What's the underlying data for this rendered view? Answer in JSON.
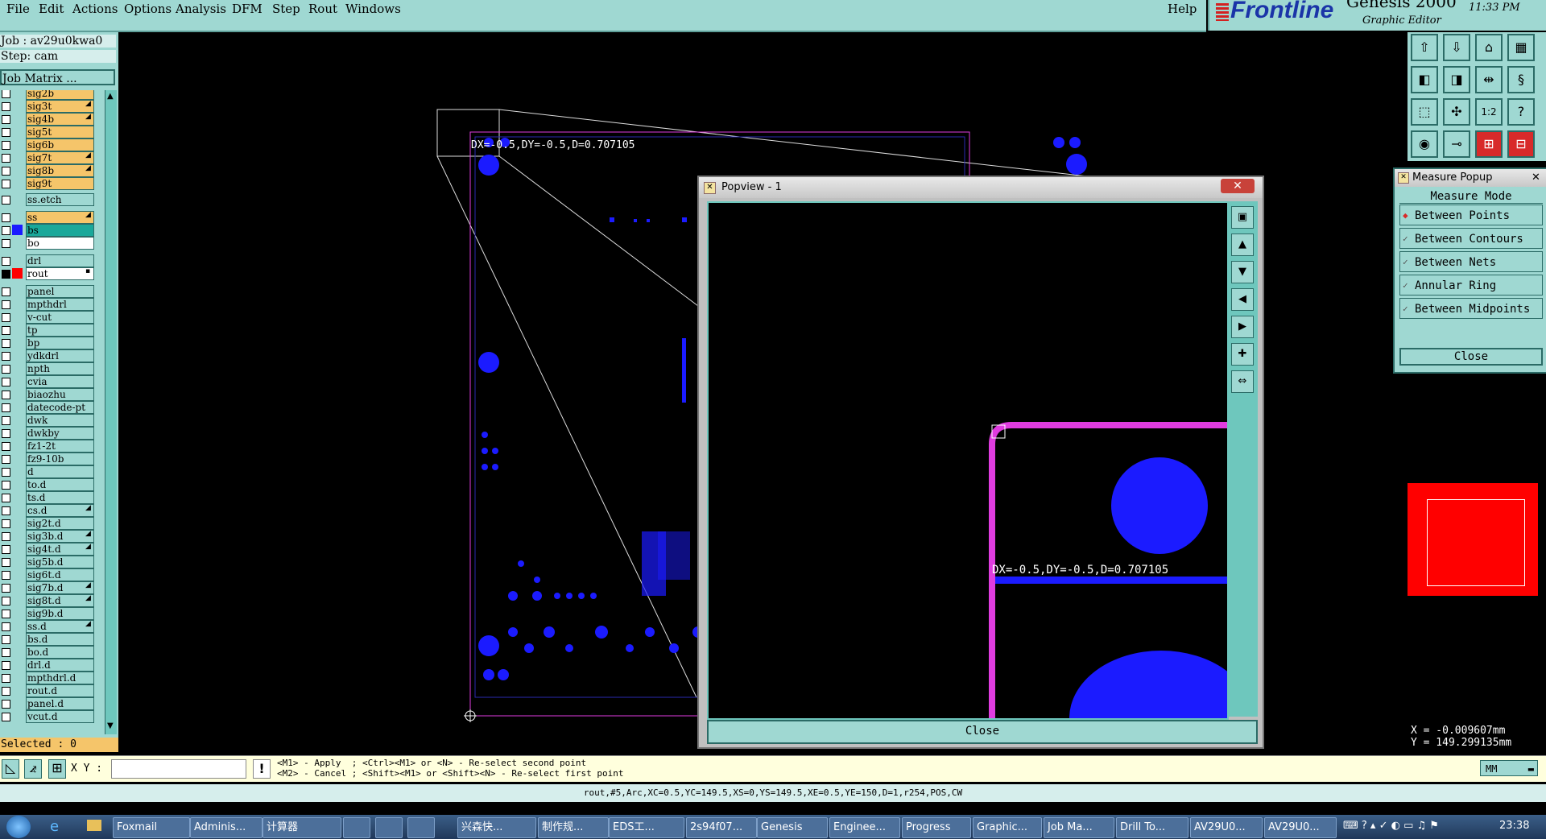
{
  "menu": [
    "File",
    "Edit",
    "Actions",
    "Options",
    "Analysis",
    "DFM",
    "Step",
    "Rout",
    "Windows"
  ],
  "help": "Help",
  "brand": {
    "logo": "Frontline",
    "product": "Genesis 2000",
    "subtitle": "Graphic Editor",
    "time": "11:33 PM"
  },
  "job": {
    "job_label": "Job : av29u0kwa0",
    "step_label": "Step: cam",
    "matrix_button": "Job Matrix ..."
  },
  "layers": [
    {
      "name": "sig2b",
      "color": "#f5c56a",
      "flag": ""
    },
    {
      "name": "sig3t",
      "color": "#f5c56a",
      "flag": "◢"
    },
    {
      "name": "sig4b",
      "color": "#f5c56a",
      "flag": "◢"
    },
    {
      "name": "sig5t",
      "color": "#f5c56a",
      "flag": ""
    },
    {
      "name": "sig6b",
      "color": "#f5c56a",
      "flag": ""
    },
    {
      "name": "sig7t",
      "color": "#f5c56a",
      "flag": "◢"
    },
    {
      "name": "sig8b",
      "color": "#f5c56a",
      "flag": "◢"
    },
    {
      "name": "sig9t",
      "color": "#f5c56a",
      "flag": ""
    },
    {
      "name": "ss.etch",
      "color": "#9fd8d2",
      "flag": ""
    },
    {
      "name": "ss",
      "color": "#f5c56a",
      "flag": "◢"
    },
    {
      "name": "bs",
      "color": "#1aa89a",
      "flag": ""
    },
    {
      "name": "bo",
      "color": "#ffffff",
      "flag": ""
    },
    {
      "name": "drl",
      "color": "#9fd8d2",
      "flag": ""
    },
    {
      "name": "rout",
      "color": "#ffffff",
      "flag": "▪"
    },
    {
      "name": "panel",
      "color": "#9fd8d2",
      "flag": ""
    },
    {
      "name": "mpthdrl",
      "color": "#9fd8d2",
      "flag": ""
    },
    {
      "name": "v-cut",
      "color": "#9fd8d2",
      "flag": ""
    },
    {
      "name": "tp",
      "color": "#9fd8d2",
      "flag": ""
    },
    {
      "name": "bp",
      "color": "#9fd8d2",
      "flag": ""
    },
    {
      "name": "ydkdrl",
      "color": "#9fd8d2",
      "flag": ""
    },
    {
      "name": "npth",
      "color": "#9fd8d2",
      "flag": ""
    },
    {
      "name": "cvia",
      "color": "#9fd8d2",
      "flag": ""
    },
    {
      "name": "biaozhu",
      "color": "#9fd8d2",
      "flag": ""
    },
    {
      "name": "datecode-pt",
      "color": "#9fd8d2",
      "flag": ""
    },
    {
      "name": "dwk",
      "color": "#9fd8d2",
      "flag": ""
    },
    {
      "name": "dwkby",
      "color": "#9fd8d2",
      "flag": ""
    },
    {
      "name": "fz1-2t",
      "color": "#9fd8d2",
      "flag": ""
    },
    {
      "name": "fz9-10b",
      "color": "#9fd8d2",
      "flag": ""
    },
    {
      "name": "d",
      "color": "#9fd8d2",
      "flag": ""
    },
    {
      "name": "to.d",
      "color": "#9fd8d2",
      "flag": ""
    },
    {
      "name": "ts.d",
      "color": "#9fd8d2",
      "flag": ""
    },
    {
      "name": "cs.d",
      "color": "#9fd8d2",
      "flag": "◢"
    },
    {
      "name": "sig2t.d",
      "color": "#9fd8d2",
      "flag": ""
    },
    {
      "name": "sig3b.d",
      "color": "#9fd8d2",
      "flag": "◢"
    },
    {
      "name": "sig4t.d",
      "color": "#9fd8d2",
      "flag": "◢"
    },
    {
      "name": "sig5b.d",
      "color": "#9fd8d2",
      "flag": ""
    },
    {
      "name": "sig6t.d",
      "color": "#9fd8d2",
      "flag": ""
    },
    {
      "name": "sig7b.d",
      "color": "#9fd8d2",
      "flag": "◢"
    },
    {
      "name": "sig8t.d",
      "color": "#9fd8d2",
      "flag": "◢"
    },
    {
      "name": "sig9b.d",
      "color": "#9fd8d2",
      "flag": ""
    },
    {
      "name": "ss.d",
      "color": "#9fd8d2",
      "flag": "◢"
    },
    {
      "name": "bs.d",
      "color": "#9fd8d2",
      "flag": ""
    },
    {
      "name": "bo.d",
      "color": "#9fd8d2",
      "flag": ""
    },
    {
      "name": "drl.d",
      "color": "#9fd8d2",
      "flag": ""
    },
    {
      "name": "mpthdrl.d",
      "color": "#9fd8d2",
      "flag": ""
    },
    {
      "name": "rout.d",
      "color": "#9fd8d2",
      "flag": ""
    },
    {
      "name": "panel.d",
      "color": "#9fd8d2",
      "flag": ""
    },
    {
      "name": "vcut.d",
      "color": "#9fd8d2",
      "flag": ""
    }
  ],
  "selected": "Selected : 0",
  "canvas": {
    "measure_text": "DX=-0.5,DY=-0.5,D=0.707105"
  },
  "popview": {
    "title": "Popview - 1",
    "measure_text": "DX=-0.5,DY=-0.5,D=0.707105",
    "close_label": "Close"
  },
  "measure_popup": {
    "title": "Measure Popup",
    "mode_label": "Measure Mode",
    "options": [
      "Between Points",
      "Between Contours",
      "Between Nets",
      "Annular Ring",
      "Between Midpoints"
    ],
    "selected_option": "Between Points",
    "close_label": "Close"
  },
  "coords": {
    "x": "X = -0.009607mm",
    "y": "Y = 149.299135mm"
  },
  "prompt": {
    "xy_label": "X Y :",
    "line1": "<M1> - Apply  ; <Ctrl><M1> or <N> - Re-select second point",
    "line2": "<M2> - Cancel ; <Shift><M1> or <Shift><N> - Re-select first point",
    "units": "MM"
  },
  "status": "rout,#5,Arc,XC=0.5,YC=149.5,XS=0,YS=149.5,XE=0.5,YE=150,D=1,r254,POS,CW",
  "taskbar": {
    "items": [
      "Foxmail",
      "Adminis...",
      "计算器",
      "",
      "",
      "",
      "兴森快...",
      "制作规...",
      "EDS工...",
      "2s94f07...",
      "Genesis",
      "Enginee...",
      "Progress",
      "Graphic...",
      "Job Ma...",
      "Drill To...",
      "AV29U0...",
      "AV29U0..."
    ],
    "clock": "23:38"
  },
  "colors": {
    "panel": "#9fd8d2",
    "pad": "#1b1bff",
    "rout": "#e03ce0",
    "selection": "#f5c56a"
  }
}
